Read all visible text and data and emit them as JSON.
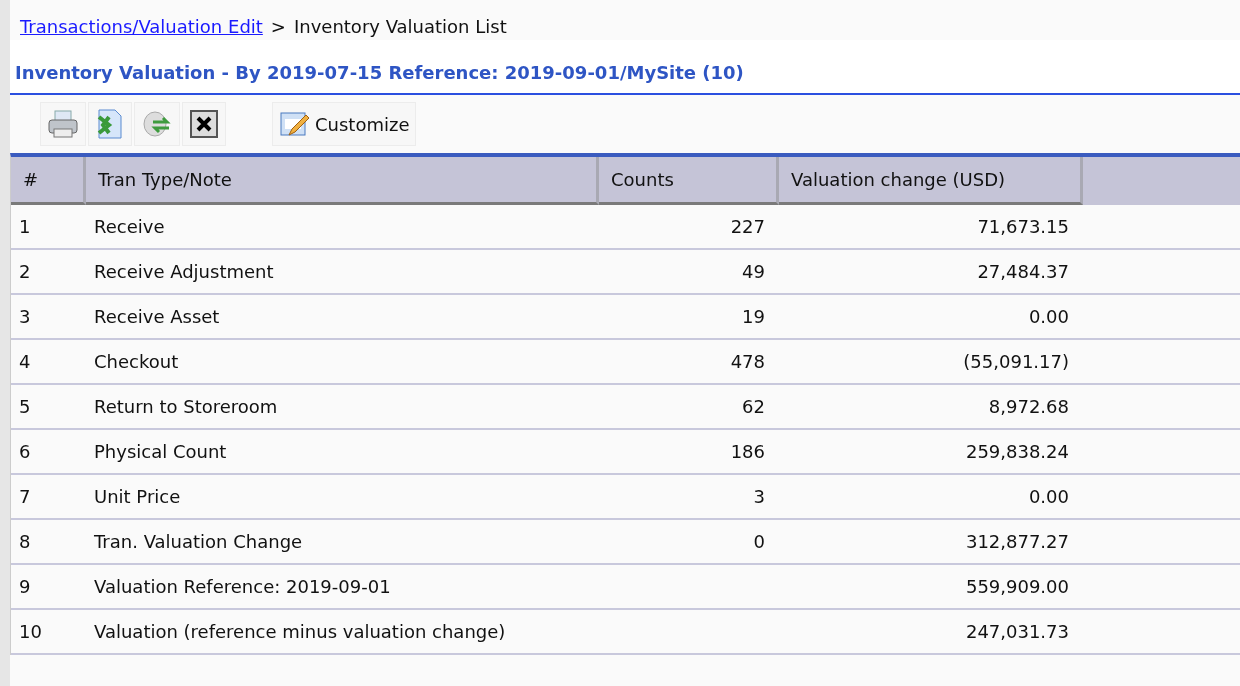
{
  "breadcrumb": {
    "link": "Transactions/Valuation Edit",
    "separator": ">",
    "current": "Inventory Valuation List"
  },
  "title": "Inventory Valuation - By 2019-07-15 Reference: 2019-09-01/MySite (10)",
  "toolbar": {
    "customize": "Customize"
  },
  "table": {
    "columns": [
      "#",
      "Tran Type/Note",
      "Counts",
      "Valuation change (USD)"
    ],
    "rows": [
      [
        "1",
        "Receive",
        "227",
        "71,673.15"
      ],
      [
        "2",
        "Receive Adjustment",
        "49",
        "27,484.37"
      ],
      [
        "3",
        "Receive Asset",
        "19",
        "0.00"
      ],
      [
        "4",
        "Checkout",
        "478",
        "(55,091.17)"
      ],
      [
        "5",
        "Return to Storeroom",
        "62",
        "8,972.68"
      ],
      [
        "6",
        "Physical Count",
        "186",
        "259,838.24"
      ],
      [
        "7",
        "Unit Price",
        "3",
        "0.00"
      ],
      [
        "8",
        "Tran. Valuation Change",
        "0",
        "312,877.27"
      ],
      [
        "9",
        "Valuation Reference: 2019-09-01",
        "",
        "559,909.00"
      ],
      [
        "10",
        "Valuation (reference minus valuation change)",
        "",
        "247,031.73"
      ]
    ]
  }
}
